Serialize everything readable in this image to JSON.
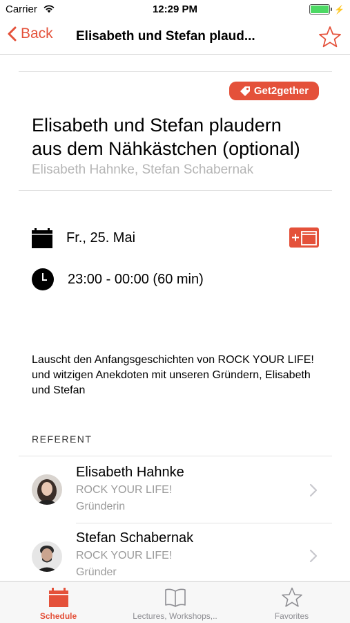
{
  "status_bar": {
    "carrier": "Carrier",
    "time": "12:29 PM"
  },
  "nav": {
    "back_label": "Back",
    "title": "Elisabeth und Stefan plaud..."
  },
  "session": {
    "tag": "Get2gether",
    "title_line1": "Elisabeth und Stefan plaudern",
    "title_line2": "aus dem Nähkästchen (optional)",
    "speakers_line": "Elisabeth Hahnke, Stefan Schabernak",
    "date": "Fr., 25. Mai",
    "time": "23:00 - 00:00 (60 min)",
    "description": "Lauscht den Anfangsgeschichten von ROCK YOUR LIFE! und witzigen Anekdoten mit unseren Gründern, Elisabeth und Stefan"
  },
  "section": {
    "referent_header": "REFERENT"
  },
  "speakers": [
    {
      "name": "Elisabeth Hahnke",
      "org": "ROCK YOUR LIFE!",
      "role": "Gründerin"
    },
    {
      "name": "Stefan Schabernak",
      "org": "ROCK YOUR LIFE!",
      "role": "Gründer"
    }
  ],
  "tabs": [
    {
      "label": "Schedule",
      "icon": "calendar-icon",
      "active": true
    },
    {
      "label": "Lectures, Workshops,..",
      "icon": "book-icon",
      "active": false
    },
    {
      "label": "Favorites",
      "icon": "star-icon",
      "active": false
    }
  ],
  "colors": {
    "accent": "#e4513a",
    "secondary_text": "#9a9a9a",
    "battery": "#4cd964"
  }
}
